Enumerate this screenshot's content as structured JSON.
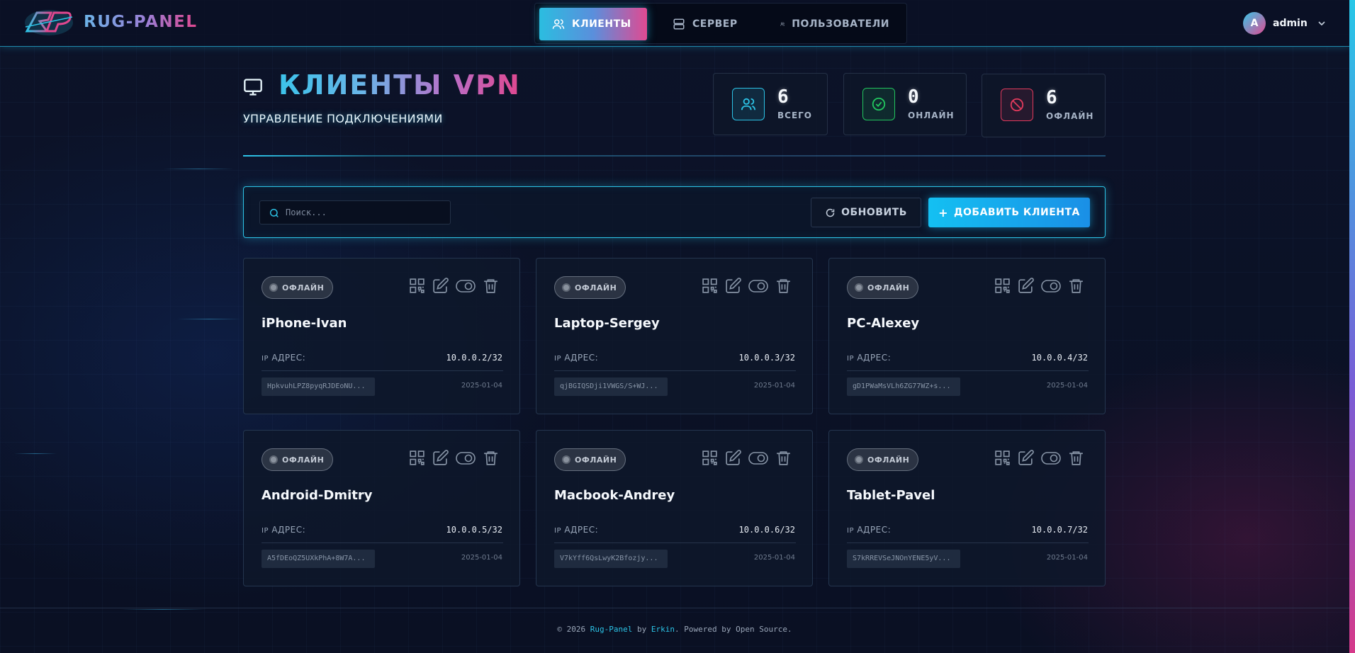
{
  "app": {
    "brand": "RUG-PANEL"
  },
  "nav": {
    "items": [
      {
        "label": "КЛИЕНТЫ",
        "icon": "users-icon",
        "active": true
      },
      {
        "label": "СЕРВЕР",
        "icon": "server-icon",
        "active": false
      },
      {
        "label": "ПОЛЬЗОВАТЕЛИ",
        "icon": "users-icon",
        "active": false
      }
    ]
  },
  "user": {
    "avatar_letter": "A",
    "name": "admin"
  },
  "page": {
    "title_main": "КЛИЕНТЫ",
    "title_accent": "VPN",
    "subtitle": "УПРАВЛЕНИЕ ПОДКЛЮЧЕНИЯМИ"
  },
  "stats": [
    {
      "value": "6",
      "label": "ВСЕГО",
      "color": "#2cc3e6",
      "icon": "users-icon"
    },
    {
      "value": "0",
      "label": "ОНЛАЙН",
      "color": "#22c55e",
      "icon": "check-circle-icon"
    },
    {
      "value": "6",
      "label": "ОФЛАЙН",
      "color": "#e03a5c",
      "icon": "ban-icon"
    }
  ],
  "toolbar": {
    "search_placeholder": "Поиск...",
    "refresh_label": "ОБНОВИТЬ",
    "add_label": "ДОБАВИТЬ КЛИЕНТА"
  },
  "clients": [
    {
      "status": "ОФЛАЙН",
      "name": "iPhone-Ivan",
      "ip_prefix": "IP",
      "ip_label": "АДРЕС:",
      "ip": "10.0.0.2/32",
      "key": "HpkvuhLPZ8pyqRJDEoNU...",
      "date": "2025-01-04"
    },
    {
      "status": "ОФЛАЙН",
      "name": "Laptop-Sergey",
      "ip_prefix": "IP",
      "ip_label": "АДРЕС:",
      "ip": "10.0.0.3/32",
      "key": "qjBGIQSDji1VWGS/S+WJ...",
      "date": "2025-01-04"
    },
    {
      "status": "ОФЛАЙН",
      "name": "PC-Alexey",
      "ip_prefix": "IP",
      "ip_label": "АДРЕС:",
      "ip": "10.0.0.4/32",
      "key": "gD1PWaMsVLh6ZG77WZ+s...",
      "date": "2025-01-04"
    },
    {
      "status": "ОФЛАЙН",
      "name": "Android-Dmitry",
      "ip_prefix": "IP",
      "ip_label": "АДРЕС:",
      "ip": "10.0.0.5/32",
      "key": "A5fDEoQZ5UXkPhA+8W7A...",
      "date": "2025-01-04"
    },
    {
      "status": "ОФЛАЙН",
      "name": "Macbook-Andrey",
      "ip_prefix": "IP",
      "ip_label": "АДРЕС:",
      "ip": "10.0.0.6/32",
      "key": "V7kYff6QsLwyK2Bfozjy...",
      "date": "2025-01-04"
    },
    {
      "status": "ОФЛАЙН",
      "name": "Tablet-Pavel",
      "ip_prefix": "IP",
      "ip_label": "АДРЕС:",
      "ip": "10.0.0.7/32",
      "key": "S7kRREVSeJNOnYENE5yV...",
      "date": "2025-01-04"
    }
  ],
  "footer": {
    "prefix": "© 2026 ",
    "app_link": "Rug-Panel",
    "by": " by ",
    "author_link": "Erkin",
    "suffix": ". Powered by Open Source."
  }
}
